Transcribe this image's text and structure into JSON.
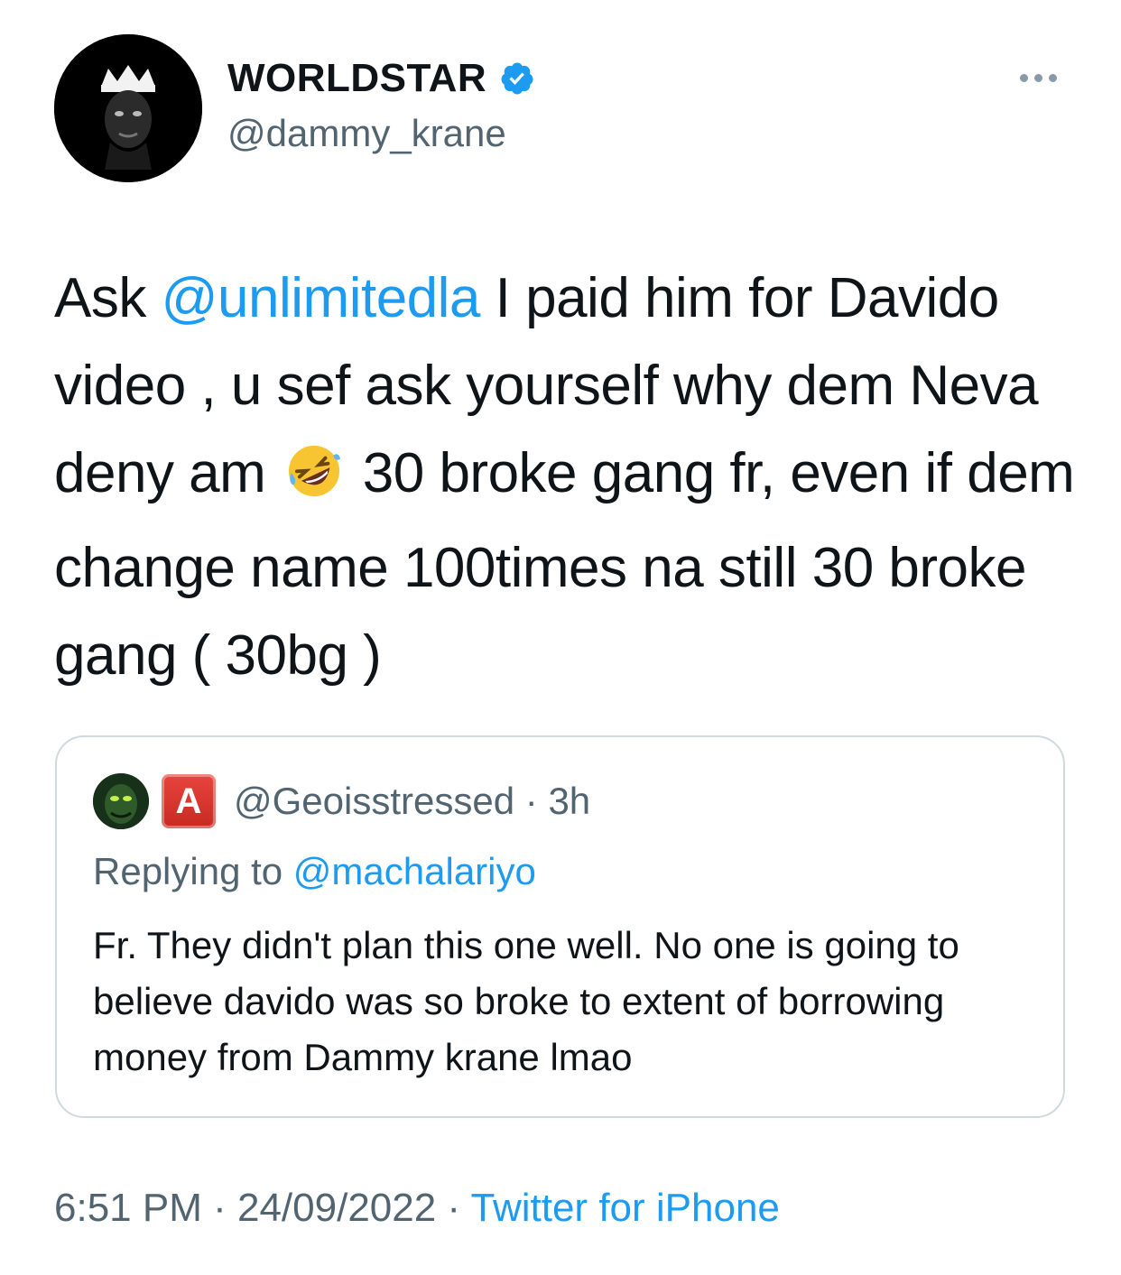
{
  "author": {
    "display_name": "WORLDSTAR",
    "handle": "@dammy_krane",
    "avatar_icon": "crowned-portrait-avatar",
    "verified_icon": "verified-badge-icon"
  },
  "tweet": {
    "segments": [
      {
        "text": "Ask  ",
        "type": "text"
      },
      {
        "text": "@unlimitedla",
        "type": "mention"
      },
      {
        "text": " I paid him  for Davido video , u sef ask yourself why dem Neva deny am ",
        "type": "text"
      },
      {
        "text": "🤣",
        "type": "emoji"
      },
      {
        "text": " 30 broke gang fr, even if dem change name 100times na still 30 broke gang ( 30bg )",
        "type": "text"
      }
    ]
  },
  "quoted": {
    "handle": "@Geoisstressed",
    "separator": "·",
    "time": "3h",
    "badge_letter": "A",
    "replying_prefix": "Replying to ",
    "replying_to": "@machalariyo",
    "body": "Fr. They didn't plan this one well. No one is going to believe  davido was so broke to extent of borrowing money from Dammy krane lmao"
  },
  "meta": {
    "time": "6:51 PM",
    "sep1": " · ",
    "date": "24/09/2022",
    "sep2": " · ",
    "source": "Twitter for iPhone"
  },
  "colors": {
    "link": "#1d9bf0",
    "secondary_text": "#536471",
    "text": "#0f1419",
    "border": "#cfd9de"
  }
}
